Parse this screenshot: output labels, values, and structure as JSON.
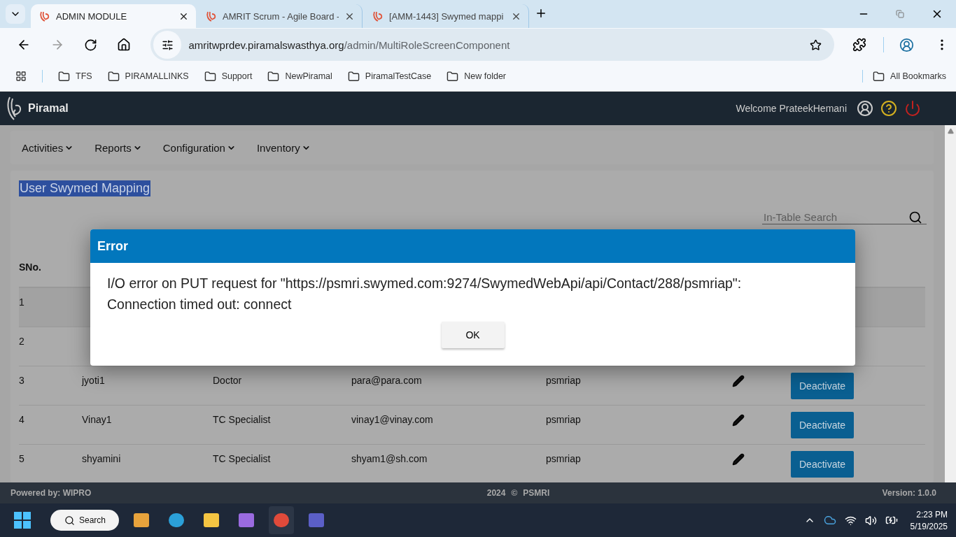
{
  "browser": {
    "tabs": [
      {
        "title": "ADMIN MODULE",
        "selected": true
      },
      {
        "title": "AMRIT Scrum - Agile Board -",
        "selected": false
      },
      {
        "title": "[AMM-1443] Swymed mappi",
        "selected": false
      }
    ],
    "address": {
      "host": "amritwprdev.piramalswasthya.org",
      "path": "/admin/MultiRoleScreenComponent"
    },
    "bookmarks": [
      "TFS",
      "PIRAMALLINKS",
      "Support",
      "NewPiramal",
      "PiramalTestCase",
      "New folder"
    ],
    "all_bookmarks": "All Bookmarks"
  },
  "app": {
    "brand": "Piramal",
    "welcome": "Welcome PrateekHemani",
    "menus": [
      "Activities",
      "Reports",
      "Configuration",
      "Inventory"
    ],
    "page_title": "User Swymed Mapping",
    "search": {
      "placeholder": "In-Table Search"
    },
    "table": {
      "columns": [
        "SNo."
      ],
      "rows": [
        {
          "cells": [
            "1"
          ]
        },
        {
          "cells": [
            "2"
          ]
        },
        {
          "cells": [
            "3",
            "jyoti1",
            "Doctor",
            "para@para.com",
            "psmriap"
          ],
          "action": "Deactivate"
        },
        {
          "cells": [
            "4",
            "Vinay1",
            "TC Specialist",
            "vinay1@vinay.com",
            "psmriap"
          ],
          "action": "Deactivate"
        },
        {
          "cells": [
            "5",
            "shyamini",
            "TC Specialist",
            "shyam1@sh.com",
            "psmriap"
          ],
          "action": "Deactivate"
        }
      ]
    },
    "footer": {
      "powered": "Powered by: WIPRO",
      "year": "2024",
      "copyright": "©",
      "org": "PSMRI",
      "version": "Version: 1.0.0"
    }
  },
  "dialog": {
    "title": "Error",
    "message": "I/O error on PUT request for \"https://psmri.swymed.com:9274/SwymedWebApi/api/Contact/288/psmriap\": Connection timed out: connect",
    "button": "OK"
  },
  "taskbar": {
    "search": "Search",
    "time": "2:23 PM",
    "date": "5/19/2025"
  }
}
